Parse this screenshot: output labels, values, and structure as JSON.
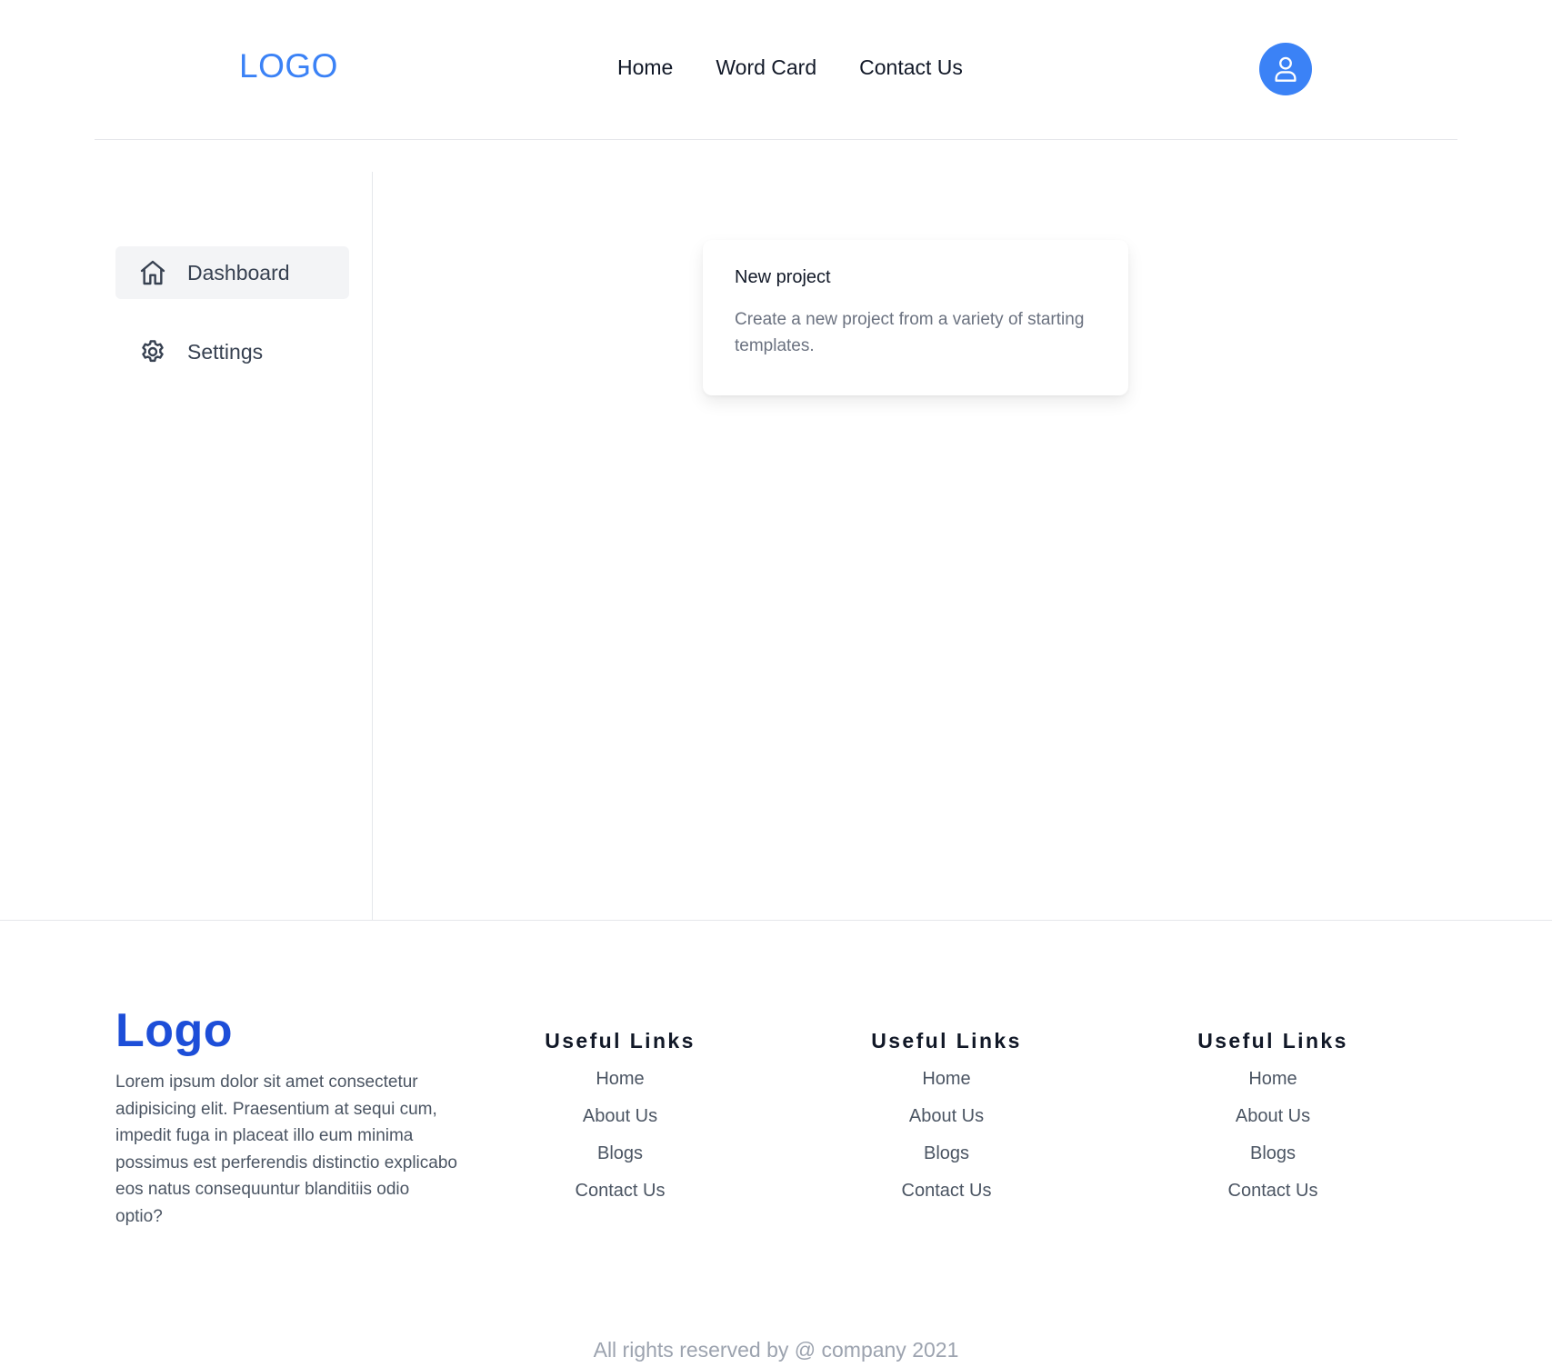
{
  "header": {
    "logo": "LOGO",
    "nav": [
      "Home",
      "Word Card",
      "Contact Us"
    ],
    "avatar_icon": "user-icon"
  },
  "sidebar": {
    "items": [
      {
        "label": "Dashboard",
        "icon": "home-icon",
        "active": true
      },
      {
        "label": "Settings",
        "icon": "gear-icon",
        "active": false
      }
    ]
  },
  "card": {
    "title": "New project",
    "description": "Create a new project from a variety of starting templates."
  },
  "footer": {
    "logo": "Logo",
    "description": "Lorem ipsum dolor sit amet consectetur adipisicing elit. Praesentium at sequi cum, impedit fuga in placeat illo eum minima possimus est perferendis distinctio explicabo eos natus consequuntur blanditiis odio optio?",
    "columns": [
      {
        "title": "Useful Links",
        "links": [
          "Home",
          "About Us",
          "Blogs",
          "Contact Us"
        ]
      },
      {
        "title": "Useful Links",
        "links": [
          "Home",
          "About Us",
          "Blogs",
          "Contact Us"
        ]
      },
      {
        "title": "Useful Links",
        "links": [
          "Home",
          "About Us",
          "Blogs",
          "Contact Us"
        ]
      }
    ],
    "copyright": "All rights reserved by @ company 2021"
  },
  "colors": {
    "primary": "#3b82f6",
    "footer_logo": "#1d4ed8",
    "active_bg": "#f3f4f6"
  }
}
